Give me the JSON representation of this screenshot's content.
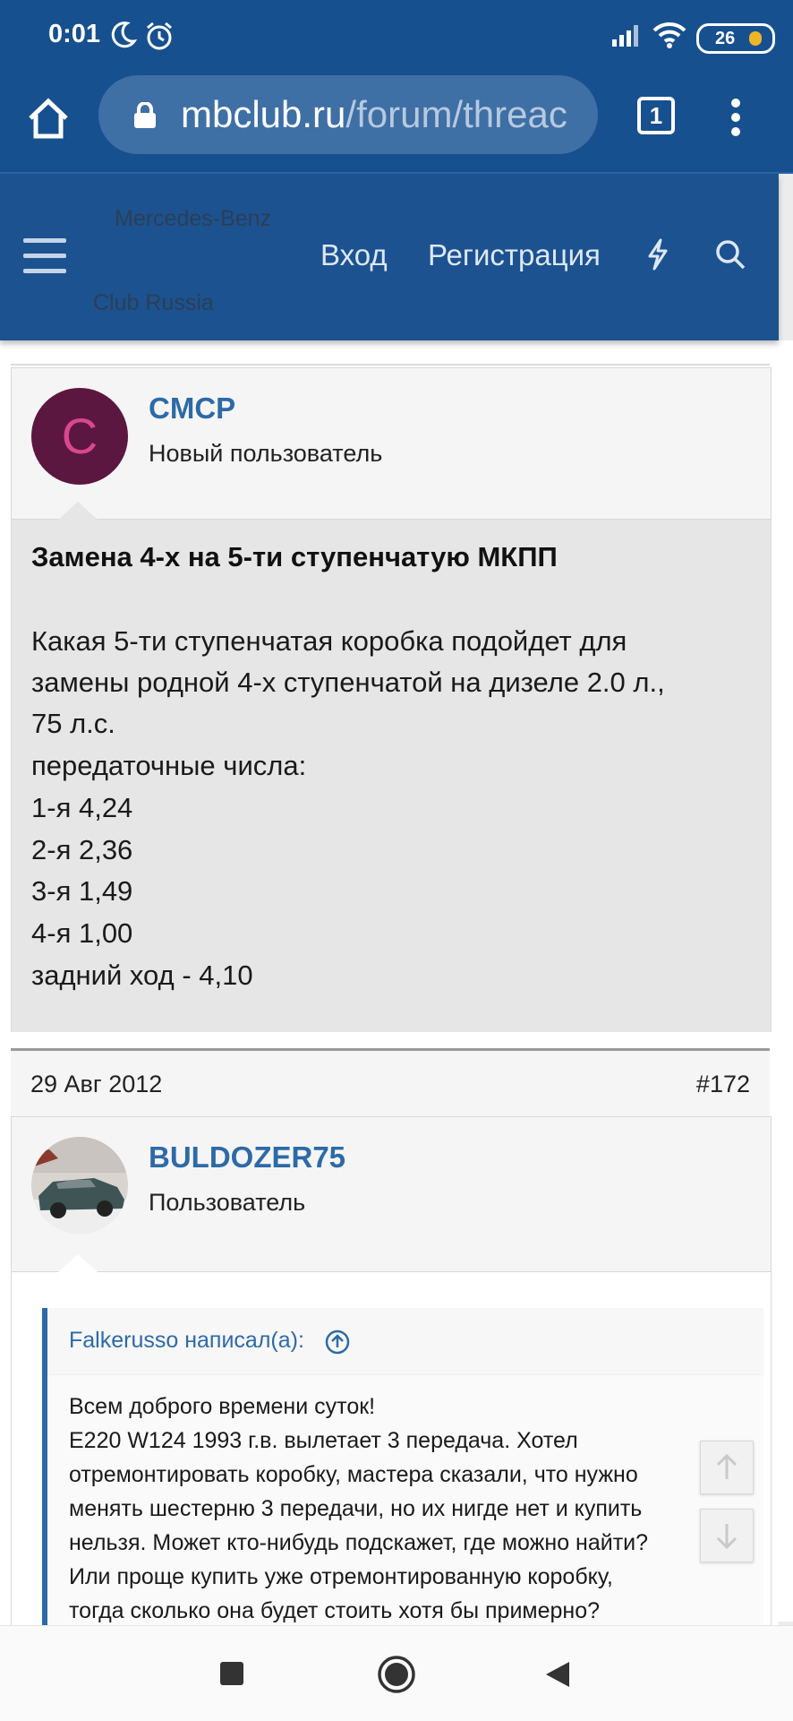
{
  "status": {
    "time": "0:01",
    "battery": "26"
  },
  "browser": {
    "url_domain": "mbclub.ru",
    "url_path": "/forum/threac",
    "tab_count": "1"
  },
  "forum_header": {
    "logo_line1": "Mercedes-Benz",
    "logo_line2": "Club Russia",
    "login": "Вход",
    "register": "Регистрация"
  },
  "post1": {
    "avatar_letter": "C",
    "avatar_color": "#5b1740",
    "avatar_letter_color": "#d9478f",
    "username": "CMCP",
    "user_title": "Новый пользователь",
    "title": "Замена 4-х на 5-ти ступенчатую МКПП",
    "lines": [
      "Какая 5-ти ступенчатая коробка подойдет для",
      "замены родной 4-х ступенчатой на дизеле 2.0 л.,",
      "75 л.с.",
      "передаточные числа:",
      "1-я 4,24",
      "2-я 2,36",
      "3-я 1,49",
      "4-я 1,00",
      "задний ход - 4,10"
    ]
  },
  "post2": {
    "date": "29 Авг 2012",
    "post_number": "#172",
    "username": "BULDOZER75",
    "user_title": "Пользователь",
    "quote_author": "Falkerusso написал(а):",
    "quote_lines": [
      "Всем доброго времени суток!",
      "E220 W124 1993 г.в. вылетает 3 передача. Хотел",
      "отремонтировать коробку, мастера сказали, что нужно",
      "менять шестерню 3 передачи, но их нигде нет и купить",
      "нельзя. Может кто-нибудь подскажет, где можно найти?",
      "Или проще купить уже отремонтированную коробку,",
      "тогда сколько она будет стоить хотя бы примерно?"
    ]
  },
  "colors": {
    "brand": "#17508f",
    "link": "#2d6aa7"
  }
}
